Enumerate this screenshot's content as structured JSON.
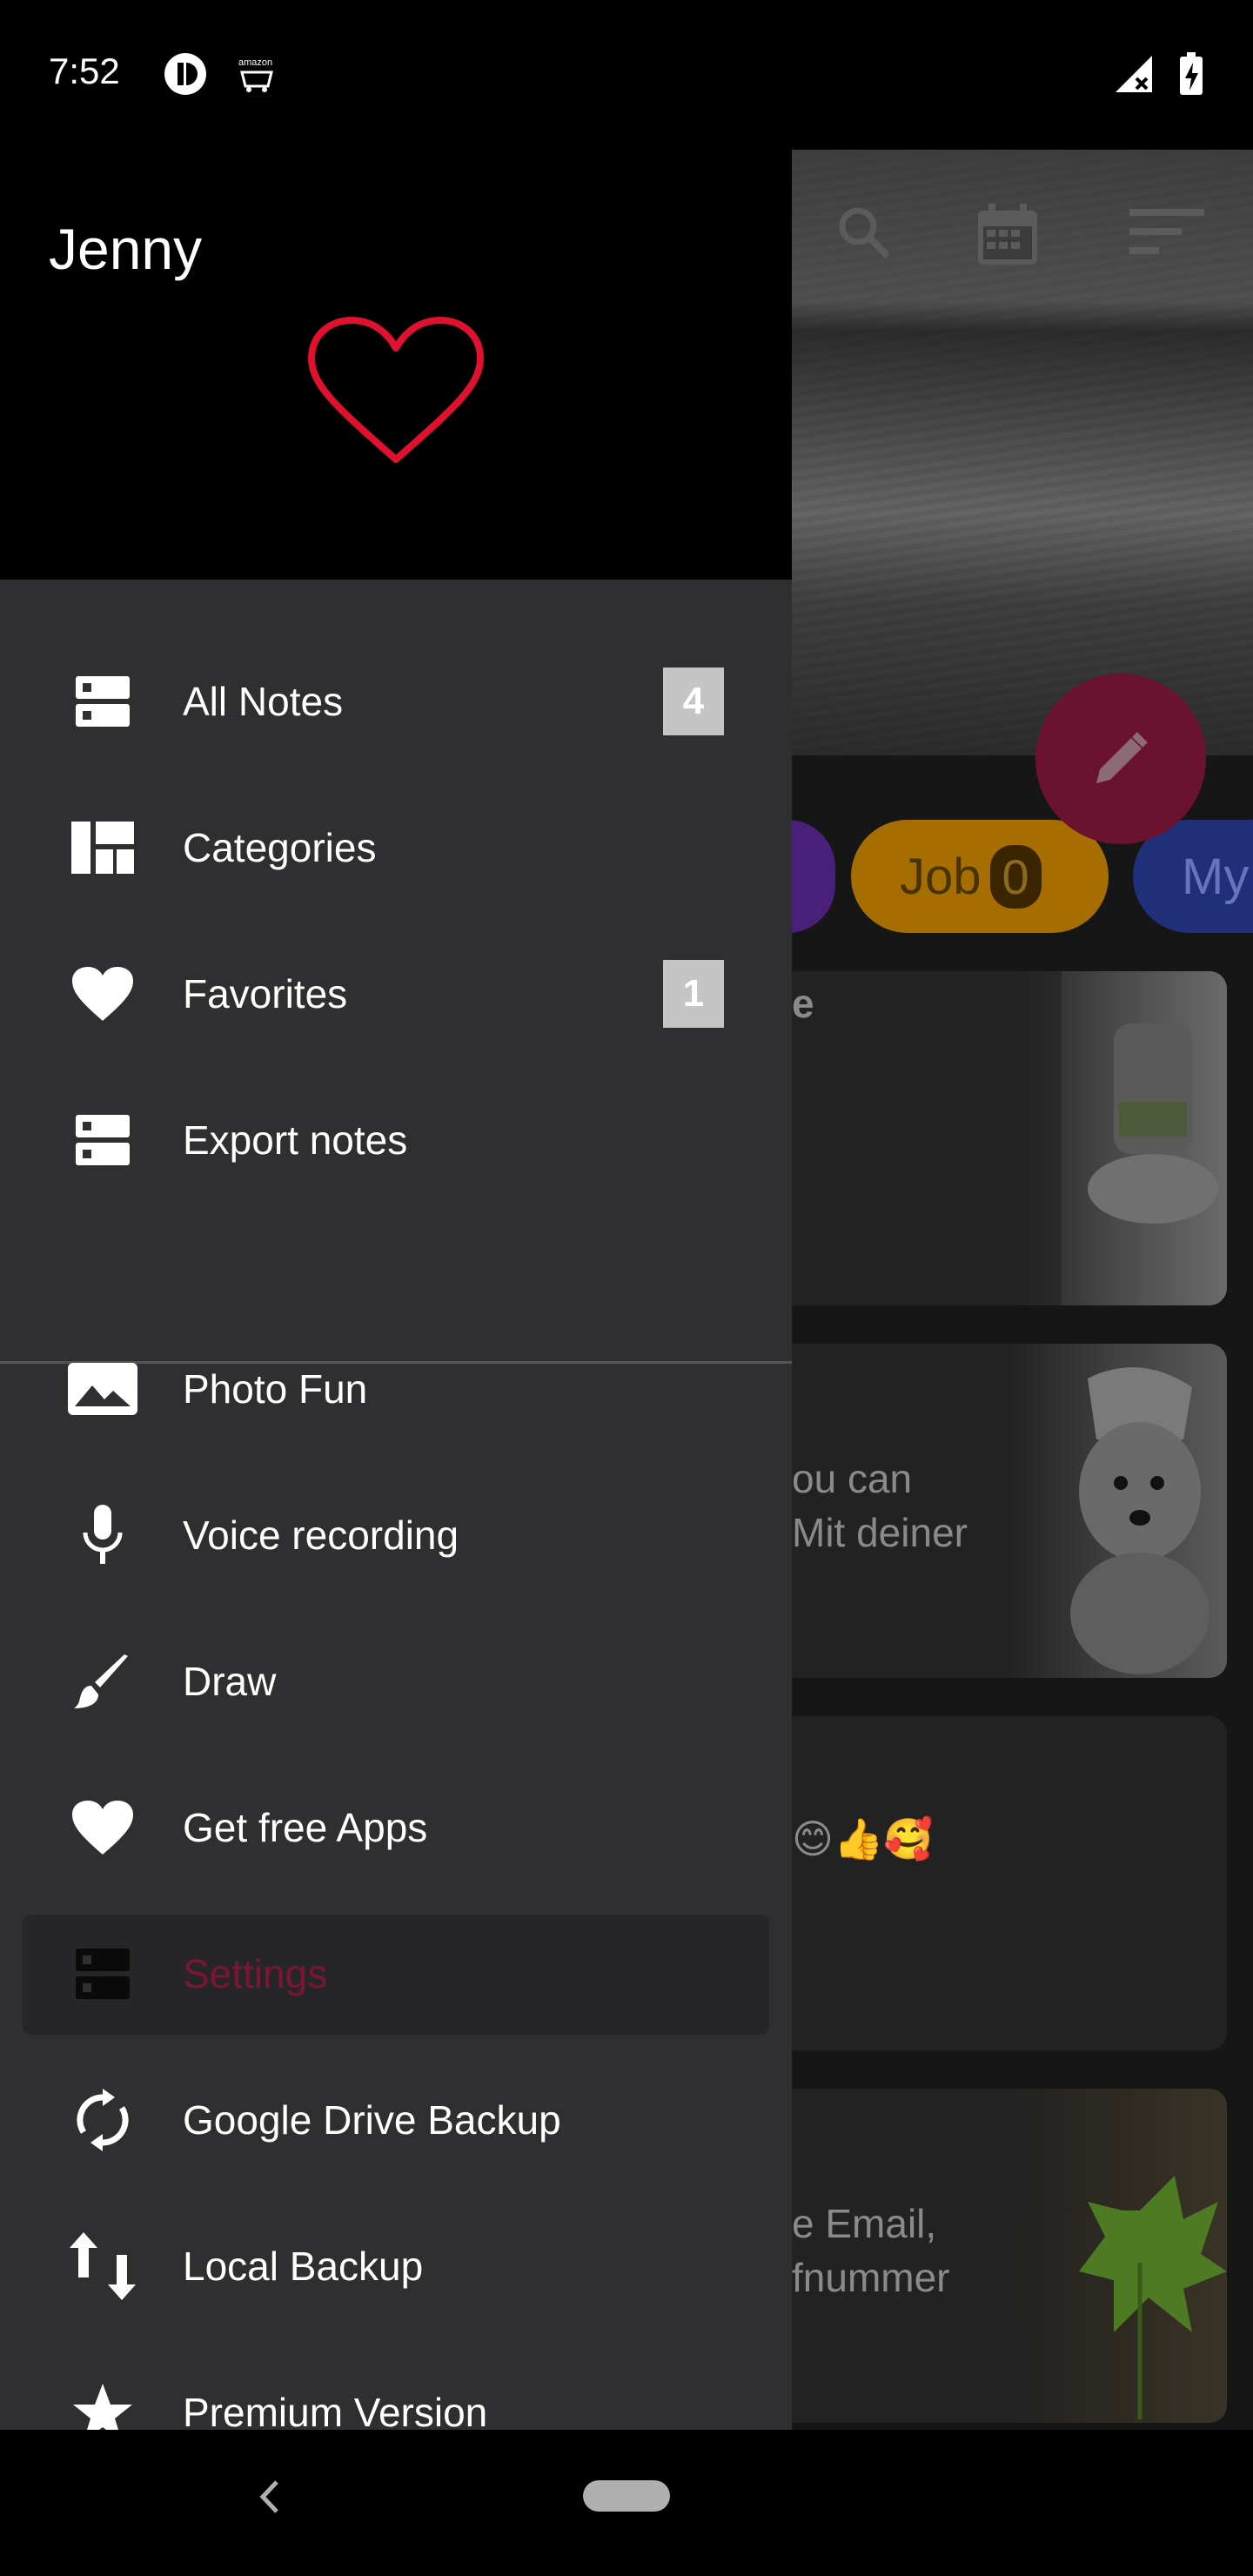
{
  "status_bar": {
    "time": "7:52",
    "left_icons": [
      "circle-app-icon",
      "amazon-icon"
    ],
    "right_icons": [
      "no-signal-icon",
      "battery-charging-icon"
    ]
  },
  "drawer": {
    "user_name": "Jenny",
    "accent_color": "#e0102f",
    "active_color": "#7a1538",
    "primary_items": [
      {
        "label": "All Notes",
        "icon": "notes-stack-icon",
        "badge": "4"
      },
      {
        "label": "Categories",
        "icon": "dashboard-icon"
      },
      {
        "label": "Favorites",
        "icon": "heart-icon",
        "badge": "1"
      },
      {
        "label": "Export notes",
        "icon": "notes-stack-icon"
      }
    ],
    "secondary_items": [
      {
        "label": "Photo Fun",
        "icon": "image-icon"
      },
      {
        "label": "Voice recording",
        "icon": "microphone-icon"
      },
      {
        "label": "Draw",
        "icon": "brush-icon"
      },
      {
        "label": "Get free Apps",
        "icon": "heart-icon"
      },
      {
        "label": "Settings",
        "icon": "notes-stack-icon",
        "active": true
      },
      {
        "label": "Google Drive Backup",
        "icon": "sync-icon"
      },
      {
        "label": "Local Backup",
        "icon": "swap-vertical-icon"
      },
      {
        "label": "Premium Version",
        "icon": "star-icon"
      }
    ]
  },
  "background_app": {
    "toolbar_icons": [
      "search-icon",
      "calendar-icon",
      "sort-icon"
    ],
    "fab_icon": "pencil-icon",
    "chips": [
      {
        "label": "Job",
        "count": "0"
      },
      {
        "label": "My"
      }
    ],
    "cards": [
      {
        "text": "e"
      },
      {
        "text": "ou can\nMit deiner"
      },
      {
        "text": "😊👍🥰"
      },
      {
        "text": "e Email,\nfnummer"
      }
    ]
  },
  "nav_bar": {
    "buttons": [
      "back-icon",
      "home-pill"
    ]
  }
}
